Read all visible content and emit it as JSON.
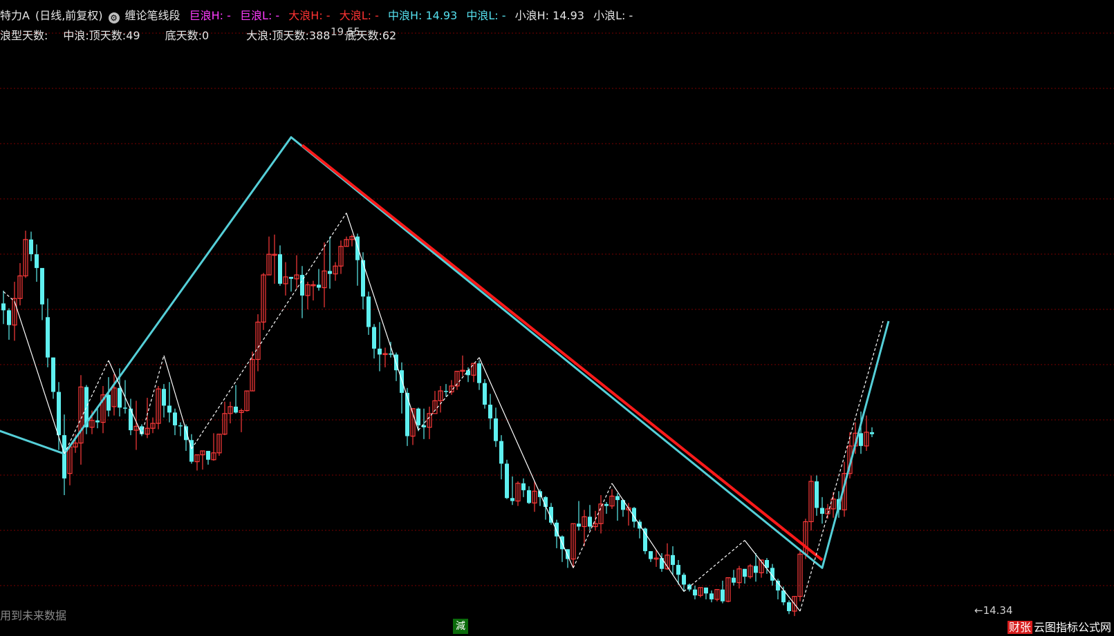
{
  "header": {
    "title": "特力A",
    "period": "(日线,前复权)",
    "indicator": "缠论笔线段",
    "ju_h": "巨浪H: -",
    "ju_l": "巨浪L: -",
    "da_h": "大浪H: -",
    "da_l": "大浪L: -",
    "zhong_h": "中浪H: 14.93",
    "zhong_l": "中浪L: -",
    "xiao_h": "小浪H: 14.93",
    "xiao_l": "小浪L: -"
  },
  "wave_days": {
    "label": "浪型天数:",
    "zhong_top": "中浪:顶天数:49",
    "zhong_bottom": "底天数:0",
    "da_top": "大浪:顶天数:388",
    "da_bottom": "底天数:62"
  },
  "footer": {
    "future_note": "用到未来数据",
    "badge": "減",
    "watermark_red": "财张",
    "watermark": "云图指标公式网"
  },
  "colors": {
    "up": "#ff3b3b",
    "down": "#5ff0f0",
    "cyan_wave": "#55cfd8",
    "red_wave": "#ff1a1a",
    "grid": "#7a0000"
  },
  "chart_data": {
    "type": "candlestick",
    "title": "",
    "price_labels": [
      {
        "text": "19.55",
        "kind": "high"
      },
      {
        "text": "14.34",
        "kind": "low"
      }
    ],
    "ylim": [
      13.9,
      19.8
    ],
    "x_count": 200,
    "candles": [
      [
        17.03,
        16.96,
        17.16,
        16.82
      ],
      [
        16.96,
        16.81,
        16.98,
        16.66
      ],
      [
        16.81,
        17.08,
        17.25,
        16.65
      ],
      [
        17.08,
        17.31,
        17.44,
        17.01
      ],
      [
        17.31,
        17.68,
        17.77,
        17.29
      ],
      [
        17.68,
        17.53,
        17.76,
        17.46
      ],
      [
        17.53,
        17.39,
        17.63,
        17.25
      ],
      [
        17.39,
        17.02,
        17.39,
        16.86
      ],
      [
        16.89,
        16.48,
        17.08,
        16.38
      ],
      [
        16.48,
        16.13,
        16.48,
        16.06
      ],
      [
        16.13,
        15.69,
        16.23,
        15.54
      ],
      [
        15.69,
        15.25,
        15.9,
        15.08
      ],
      [
        15.3,
        15.57,
        15.59,
        15.18
      ],
      [
        15.57,
        15.61,
        15.7,
        15.51
      ],
      [
        15.61,
        16.18,
        16.3,
        15.39
      ],
      [
        16.18,
        15.77,
        16.2,
        15.7
      ],
      [
        15.77,
        15.84,
        15.94,
        15.7
      ],
      [
        15.84,
        15.82,
        15.97,
        15.76
      ],
      [
        15.82,
        16.1,
        16.19,
        15.71
      ],
      [
        16.1,
        15.94,
        16.28,
        15.88
      ],
      [
        15.98,
        16.17,
        16.31,
        15.89
      ],
      [
        16.17,
        15.97,
        16.37,
        15.88
      ],
      [
        15.97,
        15.96,
        16.25,
        15.91
      ],
      [
        15.96,
        15.74,
        16.06,
        15.69
      ],
      [
        15.74,
        15.78,
        16.04,
        15.54
      ],
      [
        15.78,
        15.7,
        15.8,
        15.68
      ],
      [
        15.7,
        15.76,
        16.07,
        15.66
      ],
      [
        15.76,
        15.81,
        15.87,
        15.71
      ],
      [
        15.81,
        16.16,
        16.19,
        15.75
      ],
      [
        16.16,
        15.99,
        16.21,
        15.87
      ],
      [
        15.99,
        15.92,
        16.23,
        15.82
      ],
      [
        15.92,
        15.79,
        15.96,
        15.69
      ],
      [
        15.79,
        15.78,
        15.82,
        15.68
      ],
      [
        15.78,
        15.64,
        15.8,
        15.53
      ],
      [
        15.64,
        15.42,
        15.7,
        15.4
      ],
      [
        15.42,
        15.49,
        15.49,
        15.33
      ],
      [
        15.49,
        15.53,
        15.53,
        15.34
      ],
      [
        15.53,
        15.44,
        15.53,
        15.39
      ],
      [
        15.44,
        15.51,
        15.71,
        15.43
      ],
      [
        15.51,
        15.7,
        15.7,
        15.48
      ],
      [
        15.7,
        15.91,
        16.03,
        15.69
      ],
      [
        15.91,
        15.98,
        16.03,
        15.81
      ],
      [
        15.98,
        15.92,
        16.2,
        15.91
      ],
      [
        15.92,
        15.94,
        15.96,
        15.72
      ],
      [
        15.94,
        16.14,
        16.14,
        15.93
      ],
      [
        16.14,
        16.46,
        16.54,
        16.14
      ],
      [
        16.46,
        16.84,
        16.92,
        16.34
      ],
      [
        16.84,
        17.32,
        17.34,
        16.76
      ],
      [
        17.32,
        17.53,
        17.71,
        17.32
      ],
      [
        17.53,
        17.53,
        17.73,
        17.23
      ],
      [
        17.53,
        17.23,
        17.62,
        17.21
      ],
      [
        17.23,
        17.3,
        17.45,
        17.11
      ],
      [
        17.3,
        17.28,
        17.3,
        17.15
      ],
      [
        17.28,
        17.32,
        17.52,
        17.18
      ],
      [
        17.32,
        17.11,
        17.41,
        16.88
      ],
      [
        17.11,
        17.22,
        17.25,
        16.97
      ],
      [
        17.22,
        17.22,
        17.26,
        17.06
      ],
      [
        17.22,
        17.19,
        17.38,
        17.16
      ],
      [
        17.19,
        17.36,
        17.65,
        16.99
      ],
      [
        17.36,
        17.33,
        17.71,
        17.18
      ],
      [
        17.33,
        17.41,
        17.45,
        17.26
      ],
      [
        17.41,
        17.61,
        17.67,
        17.33
      ],
      [
        17.61,
        17.68,
        17.71,
        17.61
      ],
      [
        17.68,
        17.71,
        17.73,
        17.61
      ],
      [
        17.71,
        17.47,
        17.74,
        17.21
      ],
      [
        17.47,
        17.1,
        17.55,
        16.97
      ],
      [
        17.1,
        16.79,
        17.15,
        16.71
      ],
      [
        16.79,
        16.57,
        16.82,
        16.47
      ],
      [
        16.57,
        16.51,
        16.84,
        16.34
      ],
      [
        16.51,
        16.52,
        16.58,
        16.38
      ],
      [
        16.52,
        16.51,
        16.64,
        16.48
      ],
      [
        16.51,
        16.35,
        16.53,
        16.24
      ],
      [
        16.35,
        16.12,
        16.43,
        15.91
      ],
      [
        16.12,
        15.68,
        16.17,
        15.58
      ],
      [
        15.68,
        15.96,
        15.96,
        15.59
      ],
      [
        15.96,
        15.79,
        15.97,
        15.73
      ],
      [
        15.79,
        15.77,
        15.96,
        15.65
      ],
      [
        15.77,
        15.91,
        15.98,
        15.65
      ],
      [
        15.91,
        16.04,
        16.14,
        15.94
      ],
      [
        16.04,
        16.14,
        16.19,
        15.92
      ],
      [
        16.14,
        16.13,
        16.21,
        16.08
      ],
      [
        16.13,
        16.19,
        16.25,
        16.1
      ],
      [
        16.19,
        16.34,
        16.34,
        16.15
      ],
      [
        16.34,
        16.35,
        16.5,
        16.29
      ],
      [
        16.35,
        16.3,
        16.38,
        16.23
      ],
      [
        16.3,
        16.42,
        16.42,
        16.23
      ],
      [
        16.42,
        16.22,
        16.45,
        16.15
      ],
      [
        16.22,
        16.0,
        16.26,
        15.96
      ],
      [
        16.0,
        15.86,
        16.11,
        15.75
      ],
      [
        15.86,
        15.63,
        15.97,
        15.57
      ],
      [
        15.63,
        15.4,
        15.69,
        15.24
      ],
      [
        15.4,
        15.05,
        15.44,
        15.04
      ],
      [
        15.05,
        15.02,
        15.27,
        14.98
      ],
      [
        15.02,
        15.2,
        15.22,
        14.97
      ],
      [
        15.2,
        15.13,
        15.25,
        15.06
      ],
      [
        15.13,
        15.0,
        15.17,
        14.99
      ],
      [
        15.0,
        15.12,
        15.22,
        14.91
      ],
      [
        15.12,
        15.06,
        15.14,
        14.97
      ],
      [
        15.06,
        14.96,
        15.07,
        14.83
      ],
      [
        14.96,
        14.8,
        15.0,
        14.78
      ],
      [
        14.8,
        14.66,
        14.83,
        14.54
      ],
      [
        14.66,
        14.53,
        14.67,
        14.4
      ],
      [
        14.53,
        14.43,
        14.53,
        14.34
      ],
      [
        14.43,
        14.79,
        14.79,
        14.34
      ],
      [
        14.79,
        14.76,
        15.02,
        14.72
      ],
      [
        14.76,
        14.86,
        14.93,
        14.56
      ],
      [
        14.86,
        14.76,
        14.98,
        14.72
      ],
      [
        14.76,
        14.79,
        14.92,
        14.72
      ],
      [
        14.79,
        14.99,
        15.08,
        14.69
      ],
      [
        14.99,
        14.97,
        15.01,
        14.89
      ],
      [
        14.97,
        15.07,
        15.14,
        14.94
      ],
      [
        15.07,
        15.03,
        15.1,
        14.82
      ],
      [
        15.03,
        14.93,
        15.04,
        14.86
      ],
      [
        14.93,
        14.95,
        15.0,
        14.77
      ],
      [
        14.95,
        14.81,
        14.96,
        14.75
      ],
      [
        14.81,
        14.74,
        14.83,
        14.64
      ],
      [
        14.74,
        14.51,
        14.75,
        14.48
      ],
      [
        14.51,
        14.43,
        14.51,
        14.4
      ],
      [
        14.43,
        14.44,
        14.52,
        14.35
      ],
      [
        14.44,
        14.33,
        14.49,
        14.3
      ],
      [
        14.33,
        14.47,
        14.59,
        14.32
      ],
      [
        14.47,
        14.37,
        14.56,
        14.27
      ],
      [
        14.37,
        14.27,
        14.42,
        14.17
      ],
      [
        14.27,
        14.17,
        14.29,
        14.1
      ],
      [
        14.17,
        14.12,
        14.18,
        14.1
      ],
      [
        14.12,
        14.06,
        14.16,
        14.02
      ],
      [
        14.06,
        14.14,
        14.14,
        14.04
      ],
      [
        14.14,
        14.08,
        14.14,
        14.02
      ],
      [
        14.08,
        14.02,
        14.11,
        13.99
      ],
      [
        14.02,
        14.12,
        14.12,
        14.0
      ],
      [
        14.12,
        14.0,
        14.21,
        13.98
      ],
      [
        14.0,
        14.24,
        14.24,
        13.99
      ],
      [
        14.24,
        14.19,
        14.32,
        14.16
      ],
      [
        14.19,
        14.33,
        14.36,
        14.13
      ],
      [
        14.33,
        14.25,
        14.33,
        14.18
      ],
      [
        14.25,
        14.36,
        14.38,
        14.23
      ],
      [
        14.36,
        14.29,
        14.49,
        14.2
      ],
      [
        14.29,
        14.42,
        14.42,
        14.24
      ],
      [
        14.42,
        14.34,
        14.44,
        14.28
      ],
      [
        14.34,
        14.21,
        14.38,
        14.16
      ],
      [
        14.21,
        14.11,
        14.23,
        14.02
      ],
      [
        14.11,
        13.99,
        14.15,
        13.96
      ],
      [
        13.99,
        13.9,
        14.01,
        13.87
      ],
      [
        13.9,
        14.05,
        14.05,
        13.85
      ],
      [
        14.05,
        14.48,
        14.53,
        14.0
      ],
      [
        14.48,
        14.81,
        14.84,
        14.43
      ],
      [
        14.81,
        15.22,
        15.28,
        14.72
      ],
      [
        15.22,
        14.95,
        15.28,
        14.87
      ],
      [
        14.95,
        14.89,
        15.06,
        14.79
      ],
      [
        14.89,
        14.94,
        14.99,
        14.84
      ],
      [
        14.94,
        15.04,
        15.11,
        14.85
      ],
      [
        15.04,
        14.93,
        15.12,
        14.85
      ],
      [
        14.93,
        15.3,
        15.42,
        14.86
      ],
      [
        15.3,
        15.58,
        15.72,
        15.25
      ],
      [
        15.58,
        15.71,
        15.82,
        15.5
      ],
      [
        15.71,
        15.58,
        15.93,
        15.5
      ],
      [
        15.58,
        15.72,
        15.89,
        15.53
      ],
      [
        15.72,
        15.7,
        15.77,
        15.67
      ]
    ],
    "wave_lines": [
      {
        "name": "",
        "color_key": "cyan_wave",
        "style": "solid",
        "width": 3,
        "points": [
          [
            -8,
            15.88
          ],
          [
            11,
            15.5
          ],
          [
            52,
            18.72
          ],
          [
            148,
            14.34
          ],
          [
            160,
            16.85
          ]
        ]
      },
      {
        "name": "",
        "color_key": "red_wave",
        "style": "solid",
        "width": 4,
        "points": [
          [
            54,
            18.64
          ],
          [
            148,
            14.42
          ]
        ]
      },
      {
        "name": "",
        "color_key": "white",
        "style": "solid",
        "width": 1.2,
        "points": [
          [
            2,
            17.05
          ],
          [
            11,
            15.5
          ]
        ]
      },
      {
        "name": "",
        "color_key": "white",
        "style": "dashed",
        "width": 1.2,
        "points": [
          [
            0,
            17.15
          ],
          [
            2,
            17.05
          ]
        ]
      },
      {
        "name": "",
        "color_key": "white",
        "style": "dashed",
        "width": 1.2,
        "points": [
          [
            11,
            15.5
          ],
          [
            19,
            16.45
          ]
        ]
      },
      {
        "name": "",
        "color_key": "white",
        "style": "solid",
        "width": 1.2,
        "points": [
          [
            19,
            16.45
          ],
          [
            25,
            15.7
          ]
        ]
      },
      {
        "name": "",
        "color_key": "white",
        "style": "dashed",
        "width": 1.2,
        "points": [
          [
            25,
            15.7
          ],
          [
            29,
            16.5
          ]
        ]
      },
      {
        "name": "",
        "color_key": "white",
        "style": "solid",
        "width": 1.2,
        "points": [
          [
            29,
            16.5
          ],
          [
            34,
            15.55
          ]
        ]
      },
      {
        "name": "",
        "color_key": "white",
        "style": "dashed",
        "width": 1.2,
        "points": [
          [
            34,
            15.55
          ],
          [
            62,
            17.95
          ]
        ]
      },
      {
        "name": "",
        "color_key": "white",
        "style": "solid",
        "width": 1.2,
        "points": [
          [
            62,
            17.95
          ],
          [
            75,
            15.74
          ]
        ]
      },
      {
        "name": "",
        "color_key": "white",
        "style": "dashed",
        "width": 1.2,
        "points": [
          [
            75,
            15.74
          ],
          [
            86,
            16.48
          ]
        ]
      },
      {
        "name": "",
        "color_key": "white",
        "style": "solid",
        "width": 1.2,
        "points": [
          [
            86,
            16.48
          ],
          [
            103,
            14.34
          ]
        ]
      },
      {
        "name": "",
        "color_key": "white",
        "style": "dashed",
        "width": 1.2,
        "points": [
          [
            103,
            14.34
          ],
          [
            110,
            15.2
          ]
        ]
      },
      {
        "name": "",
        "color_key": "white",
        "style": "solid",
        "width": 1.2,
        "points": [
          [
            110,
            15.2
          ],
          [
            123,
            14.1
          ]
        ]
      },
      {
        "name": "",
        "color_key": "white",
        "style": "dashed",
        "width": 1.2,
        "points": [
          [
            123,
            14.1
          ],
          [
            134,
            14.62
          ]
        ]
      },
      {
        "name": "",
        "color_key": "white",
        "style": "solid",
        "width": 1.2,
        "points": [
          [
            134,
            14.62
          ],
          [
            144,
            13.9
          ]
        ]
      },
      {
        "name": "",
        "color_key": "white",
        "style": "dashed",
        "width": 1.2,
        "points": [
          [
            144,
            13.9
          ],
          [
            159,
            16.85
          ]
        ]
      }
    ]
  }
}
